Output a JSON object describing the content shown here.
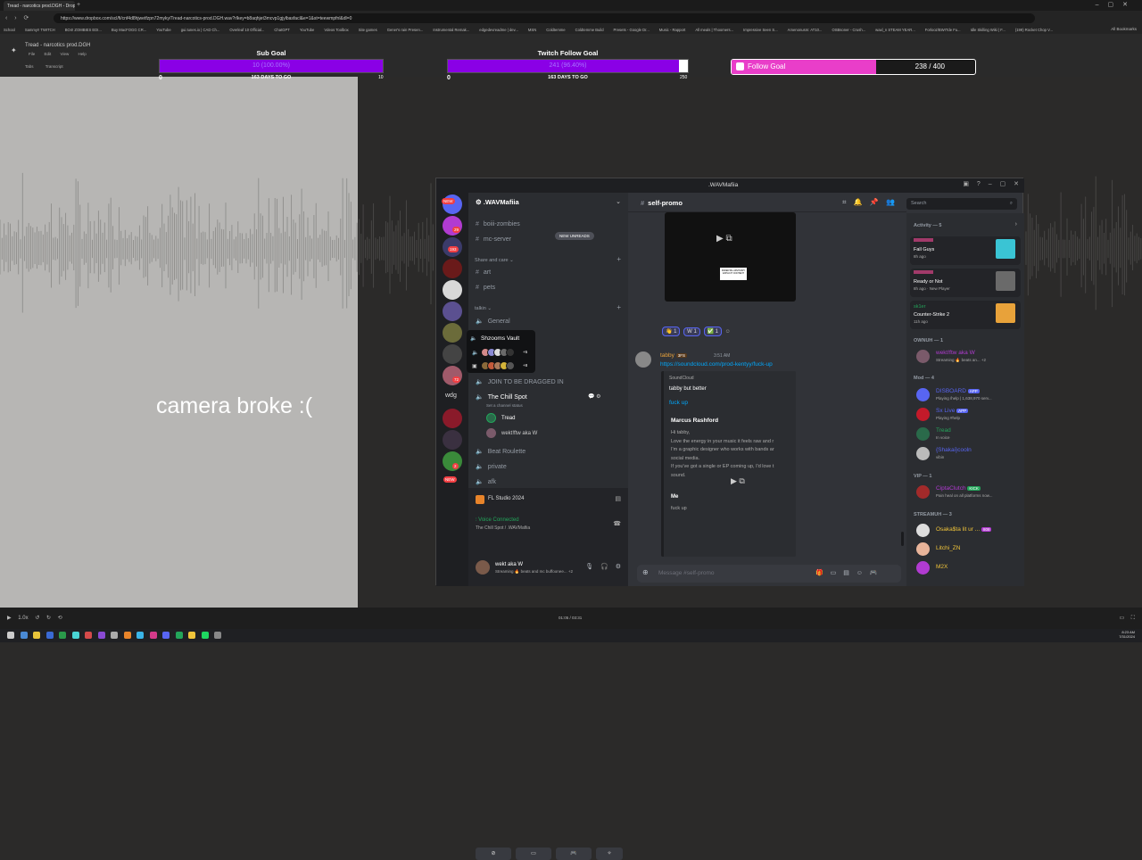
{
  "browser": {
    "tab_title": "Tread - narcotics prod.DGH - Dropbox",
    "url": "https://www.dropbox.com/scl/fi/cnf4d8hjwetfzpn72myky/Tread-narcotics-prod.DGH.wav?rlkey=b8aqhjet3mcvp1gjylbasfacl&e=1&st=teewmpfnl&dl=0",
    "bookmarks": [
      "School",
      "Sammy!! TWITCH",
      "BO4! ZOMBIES EDI...",
      "Buy MacFOGG CR...",
      "YouTube",
      "gui.tunes.io | CAD Ch...",
      "Overleaf 10 Official...",
      "ChatGPT",
      "YouTube",
      "Vdeos Toolbox",
      "Site games",
      "Gener's rain Presen...",
      "Instrumental Remak...",
      "edgedevreadme | dev...",
      "MSN",
      "Coldtemme",
      "Coldtemme Build",
      "Presets - Google Dr...",
      "Music - Rapport",
      "All meals | Thoomers...",
      "Impressive Seen S...",
      "Amenonusm: AT10...",
      "OSBsoner - Crush...",
      "waxl_n STEAM YEAR...",
      "Forlooz/BWITde Fu...",
      "Idle Skilling Wiki | F...",
      "(199) Rocket Chop V..."
    ],
    "all_bookmarks": "All Bookmarks"
  },
  "dropbox": {
    "file_title": "Tread - narcotics prod.DGH",
    "menu": [
      "File",
      "Edit",
      "View",
      "Help"
    ],
    "tab1": "Tabs",
    "tab2": "Transcript"
  },
  "overlay": {
    "camera_text": "camera broke :(",
    "sub_goal": {
      "title": "Sub Goal",
      "value_text": "10 (100.00%)",
      "min": "0",
      "max": "10",
      "days": "163 DAYS TO GO",
      "fraction": 1.0
    },
    "twitch_goal": {
      "title": "Twitch Follow Goal",
      "value_text": "241 (96.40%)",
      "min": "0",
      "max": "250",
      "days": "163 DAYS TO GO",
      "fraction": 0.964
    },
    "follow_goal": {
      "label": "Follow Goal",
      "count": "238 / 400",
      "fraction": 0.595,
      "color": "#e93ec9"
    }
  },
  "player": {
    "time": "01:05 / 03:31",
    "speed": "1.0x"
  },
  "taskbar": {
    "time": "8:23 AM",
    "date": "7/31/2024"
  },
  "discord": {
    "window_title": ".WAVMafiia",
    "server_name": ".WAVMafiia",
    "new_unreads": "NEW UNREADS",
    "badges": {
      "new1": "NEW",
      "b29": "29",
      "b193": "193",
      "b72": "72",
      "b2": "2",
      "new2": "NEW",
      "wdg": "wdg"
    },
    "channels": {
      "c1": "boiii-zombies",
      "c2": "mc-server",
      "cat_share": "Share and care",
      "c3": "art",
      "c4": "pets",
      "cat_talk": "talkin",
      "v1": "General",
      "vault": "Shzooms Vault",
      "vault_more1": "+5",
      "vault_more2": "+8",
      "v2": "JOIN TO BE DRAGGED IN",
      "v3": "The Chill Spot",
      "v3_status": "Set a channel status",
      "u1": "Tread",
      "u2": "wekt!ftw aka W",
      "v4": "Beat Roulette",
      "v5": "private",
      "v6": "afk"
    },
    "panel": {
      "activity": "FL Studio 2024",
      "voice": "Voice Connected",
      "voice_sub": "The Chill Spot / .WAVMafiia",
      "me_name": "wekt aka W",
      "me_status": "Streaming 🔥 beats and mc buffoonee... +2"
    },
    "chat": {
      "channel": "self-promo",
      "reactions": [
        "👋 1",
        "W 1",
        "✅ 1"
      ],
      "author": "tabby",
      "author_tag": "3FS",
      "time": "3:51 AM",
      "link": "https://soundcloud.com/prod-kentyy/fuck-up",
      "embed_provider": "SoundCloud",
      "embed_title": "tabby but better",
      "embed_link": "fuck up",
      "embed_name": "Marcus Rashford",
      "embed_lines": [
        "Hi tabby,",
        "Love the energy in your music it feels raw and r",
        "I'm a graphic designer who works with bands ar",
        "social media.",
        "If you've got a single or EP coming up, I'd love t",
        "sound."
      ],
      "embed_me": "Me",
      "embed_reply": "fuck up",
      "composer_placeholder": "Message #self-promo",
      "parental": "PARENTAL ADVISORY EXPLICIT CONTENT"
    },
    "search_placeholder": "Search",
    "members": {
      "activity_header": "Activity — 5",
      "acts": [
        {
          "game": "Fall Guys",
          "meta": "8h ago"
        },
        {
          "game": "Ready or Not",
          "meta": "8h ago · New Player"
        },
        {
          "user": "sk1er",
          "game": "Counter-Strike 2",
          "meta": "11h ago"
        }
      ],
      "owner_header": "OWNUH — 1",
      "owner": {
        "name": "wekt!ftw aka W",
        "status": "Streaming 🔥 beats an... +2"
      },
      "mod_header": "Mod — 4",
      "mods": [
        {
          "name": "DISBOARD",
          "tag": "APP",
          "status": "Playing /help | 1,638,970 serv..."
        },
        {
          "name": "Sx Live",
          "tag": "APP",
          "status": "Playing #help"
        },
        {
          "name": "Tread",
          "status": "In voice"
        },
        {
          "name": "{Shakai}cooln",
          "status": "vibin"
        }
      ],
      "vip_header": "VIP — 1",
      "vip": {
        "name": "CiptaClutch",
        "tag": "KICK",
        "status": "Pain heal on all platforms now..."
      },
      "streamuh_header": "STREAMUH — 3",
      "streamuh": [
        {
          "name": "Osaka$ta lit ur ...",
          "tag": "808"
        },
        {
          "name": "Litchi_ZN"
        },
        {
          "name": "M2X"
        }
      ]
    }
  }
}
